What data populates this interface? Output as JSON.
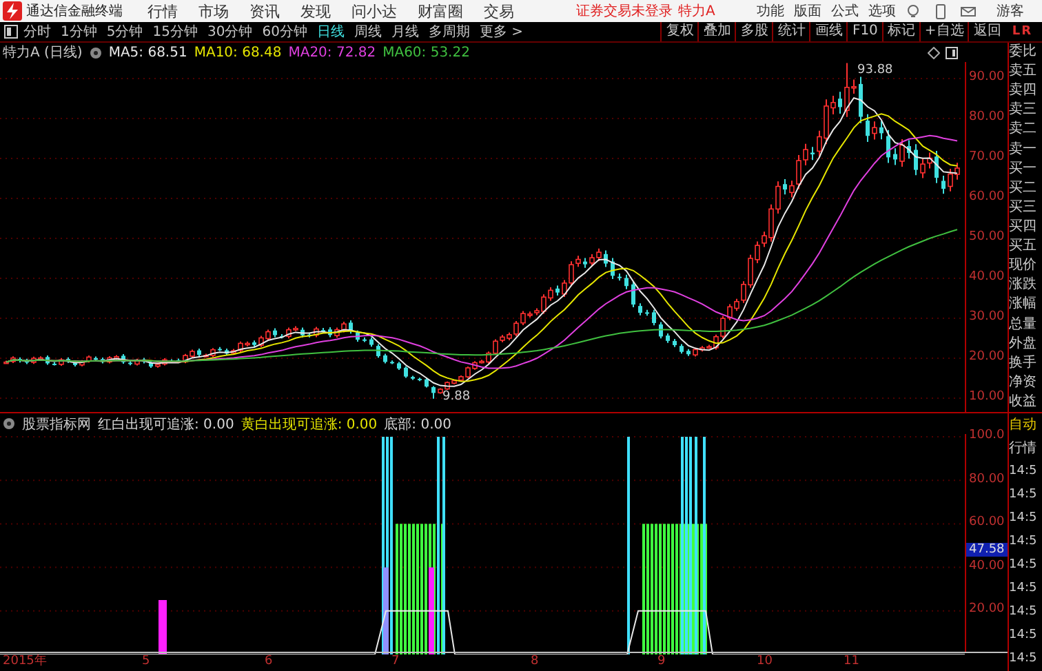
{
  "menubar": {
    "app_title": "通达信金融终端",
    "menus": [
      "行情",
      "市场",
      "资讯",
      "发现",
      "问小达",
      "财富圈",
      "交易"
    ],
    "login_status": "证券交易未登录",
    "stock_name": "特力A",
    "tools": [
      "功能",
      "版面",
      "公式",
      "选项"
    ],
    "user": "游客"
  },
  "period_tabs": [
    {
      "label": "分时",
      "selected": false
    },
    {
      "label": "1分钟",
      "selected": false
    },
    {
      "label": "5分钟",
      "selected": false
    },
    {
      "label": "15分钟",
      "selected": false
    },
    {
      "label": "30分钟",
      "selected": false
    },
    {
      "label": "60分钟",
      "selected": false
    },
    {
      "label": "日线",
      "selected": true
    },
    {
      "label": "周线",
      "selected": false
    },
    {
      "label": "月线",
      "selected": false
    },
    {
      "label": "多周期",
      "selected": false
    },
    {
      "label": "更多 >",
      "selected": false
    }
  ],
  "chart_tools": [
    "复权",
    "叠加",
    "多股",
    "统计",
    "画线",
    "F10",
    "标记",
    "+自选",
    "返回"
  ],
  "corner_badge": [
    "L",
    "R"
  ],
  "chart_title": "特力A (日线)",
  "moving_averages": [
    {
      "label": "MA5: 68.51",
      "color": "#e8e8e8"
    },
    {
      "label": "MA10: 68.48",
      "color": "#e6e600"
    },
    {
      "label": "MA20: 72.82",
      "color": "#e040e0"
    },
    {
      "label": "MA60: 53.22",
      "color": "#40c040"
    }
  ],
  "price_axis": [
    "90.00",
    "80.00",
    "70.00",
    "60.00",
    "50.00",
    "40.00",
    "30.00",
    "20.00",
    "10.00"
  ],
  "price_annotations": [
    "93.88",
    "9.88"
  ],
  "indicator": {
    "source": "股票指标网",
    "values": [
      {
        "label": "红白出现可追涨: 0.00",
        "color": "#d8d8d8"
      },
      {
        "label": "黄白出现可追涨: 0.00",
        "color": "#e6e600"
      },
      {
        "label": "底部: 0.00",
        "color": "#d8d8d8"
      }
    ]
  },
  "indicator_axis": [
    "100.0",
    "80.00",
    "60.00",
    "40.00",
    "20.00"
  ],
  "indicator_current": "47.58",
  "date_axis": [
    "2015年",
    "5",
    "6",
    "7",
    "8",
    "9",
    "10",
    "11"
  ],
  "side_panel": {
    "quote_labels": [
      "委比",
      "卖五",
      "卖四",
      "卖三",
      "卖二",
      "卖一",
      "买一",
      "买二",
      "买三",
      "买四",
      "买五",
      "现价",
      "涨跌",
      "涨幅",
      "总量",
      "外盘",
      "换手",
      "净资",
      "收益"
    ],
    "mode_labels": [
      "自动",
      "行情"
    ],
    "trade_times": [
      "14:5",
      "14:5",
      "14:5",
      "14:5",
      "14:5",
      "14:5",
      "14:5",
      "14:5",
      "14:5"
    ]
  }
}
